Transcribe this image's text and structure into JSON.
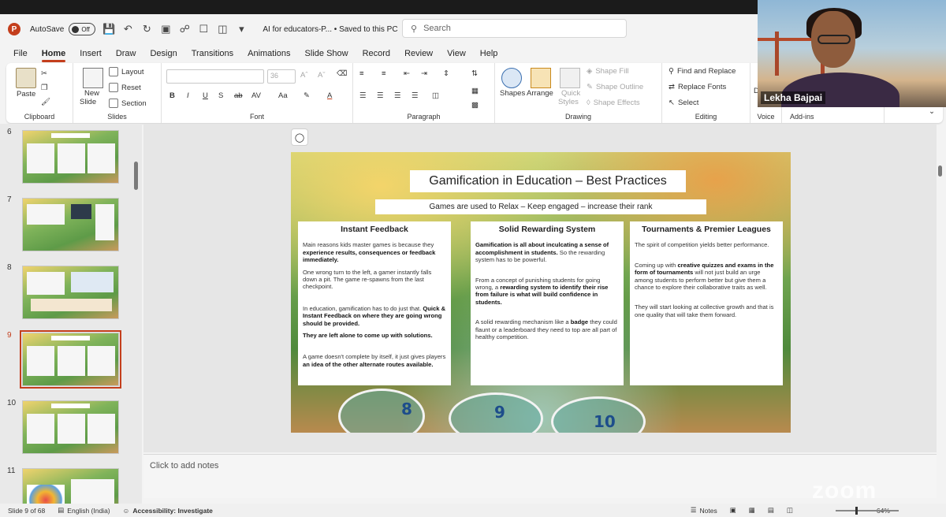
{
  "titlebar": {
    "autosave_label": "AutoSave",
    "autosave_state": "Off",
    "doc_title": "AI for educators-P...  • Saved to this PC",
    "search_placeholder": "Search"
  },
  "tabs": [
    "File",
    "Home",
    "Insert",
    "Draw",
    "Design",
    "Transitions",
    "Animations",
    "Slide Show",
    "Record",
    "Review",
    "View",
    "Help"
  ],
  "active_tab": "Home",
  "ribbon": {
    "clipboard": {
      "label": "Clipboard",
      "paste": "Paste"
    },
    "slides": {
      "label": "Slides",
      "new_slide": "New",
      "new_slide2": "Slide",
      "layout": "Layout",
      "reset": "Reset",
      "section": "Section"
    },
    "font": {
      "label": "Font",
      "size": "36"
    },
    "paragraph": {
      "label": "Paragraph"
    },
    "drawing": {
      "label": "Drawing",
      "shapes": "Shapes",
      "arrange": "Arrange",
      "quick_styles": "Quick",
      "quick_styles2": "Styles",
      "shape_fill": "Shape Fill",
      "shape_outline": "Shape Outline",
      "shape_effects": "Shape Effects"
    },
    "editing": {
      "label": "Editing",
      "find_replace": "Find and Replace",
      "replace_fonts": "Replace Fonts",
      "select": "Select"
    },
    "voice": {
      "label": "Voice"
    },
    "addins": {
      "label": "Add-ins"
    }
  },
  "thumbnails": [
    {
      "num": "6"
    },
    {
      "num": "7"
    },
    {
      "num": "8"
    },
    {
      "num": "9",
      "active": true
    },
    {
      "num": "10"
    },
    {
      "num": "11"
    }
  ],
  "slide": {
    "title": "Gamification in Education – Best Practices",
    "subtitle": "Games are used to Relax – Keep engaged – increase their rank",
    "columns": [
      {
        "heading": "Instant Feedback",
        "paras": [
          {
            "pre": "Main reasons kids master games is because they ",
            "bold": "experience results, consequences or feedback immediately.",
            "post": ""
          },
          {
            "pre": "One wrong turn to the left, a gamer instantly falls down a pit. The game re-spawns from the last checkpoint.",
            "bold": "",
            "post": ""
          },
          {
            "pre": "In education, gamification has to do just that. ",
            "bold": "Quick & Instant Feedback on where they are going wrong should be provided.",
            "post": ""
          },
          {
            "pre": "",
            "bold": "They are left alone to come up with solutions.",
            "post": ""
          },
          {
            "pre": "A game doesn't complete by itself, it just gives players ",
            "bold": "an idea of the other alternate routes available.",
            "post": ""
          }
        ]
      },
      {
        "heading": "Solid Rewarding System",
        "paras": [
          {
            "pre": "",
            "bold": "Gamification is all about inculcating a sense of accomplishment in students.",
            "post": " So the rewarding system has to be powerful."
          },
          {
            "pre": "From a concept of punishing students for going wrong, a ",
            "bold": "rewarding system to identify their rise from failure is what will build confidence in students.",
            "post": ""
          },
          {
            "pre": "A solid rewarding mechanism like a ",
            "bold": "badge",
            "post": " they could flaunt or a leaderboard they need to top are all part of healthy competition."
          }
        ]
      },
      {
        "heading": "Tournaments & Premier Leagues",
        "paras": [
          {
            "pre": "The spirit of competition yields better performance.",
            "bold": "",
            "post": ""
          },
          {
            "pre": "Coming up with ",
            "bold": "creative quizzes and exams in the form of tournaments",
            "post": " will not just build an urge among students to perform better but give them a chance to explore their collaborative traits as well."
          },
          {
            "pre": "They will start looking at collective growth and that is one quality that will take them forward.",
            "bold": "",
            "post": ""
          }
        ]
      }
    ],
    "board_numbers": [
      "8",
      "9",
      "10"
    ]
  },
  "notes_placeholder": "Click to add notes",
  "status": {
    "slide_count": "Slide 9 of 68",
    "language": "English (India)",
    "accessibility": "Accessibility: Investigate",
    "notes": "Notes",
    "zoom": "64%"
  },
  "webcam": {
    "name": "Lekha Bajpai"
  },
  "watermark": "zoom",
  "colors": {
    "accent": "#c43e1c",
    "save_icon": "#8a3fb8"
  }
}
